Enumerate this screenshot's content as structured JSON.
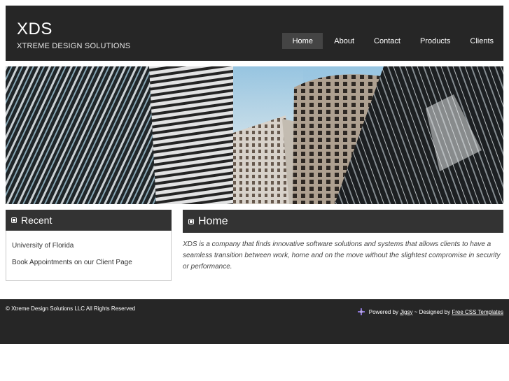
{
  "header": {
    "logo_title": "XDS",
    "logo_subtitle": "XTREME DESIGN SOLUTIONS"
  },
  "nav": {
    "items": [
      {
        "label": "Home",
        "active": true
      },
      {
        "label": "About"
      },
      {
        "label": "Contact"
      },
      {
        "label": "Products"
      },
      {
        "label": "Clients"
      }
    ]
  },
  "sidebar": {
    "title": "Recent",
    "links": [
      "University of Florida",
      "Book Appointments on our Client Page"
    ]
  },
  "main": {
    "title": "Home",
    "body": "XDS is a company that finds innovative software solutions and systems that allows clients to have a seamless transition between work, home and on the move without the slightest compromise in security or performance."
  },
  "footer": {
    "copyright": "© Xtreme Design Solutions LLC All Rights Reserved",
    "powered_prefix": "Powered by",
    "powered_link": "Jigsy",
    "designed_prefix": "~ Designed by",
    "designed_link": "Free CSS Templates"
  },
  "colors": {
    "header_bg": "#262626",
    "box_head_bg": "#333333",
    "active_nav_bg": "#444444"
  },
  "icons": {
    "bullet": "square-bullet-icon",
    "powered": "jigsy-icon"
  }
}
